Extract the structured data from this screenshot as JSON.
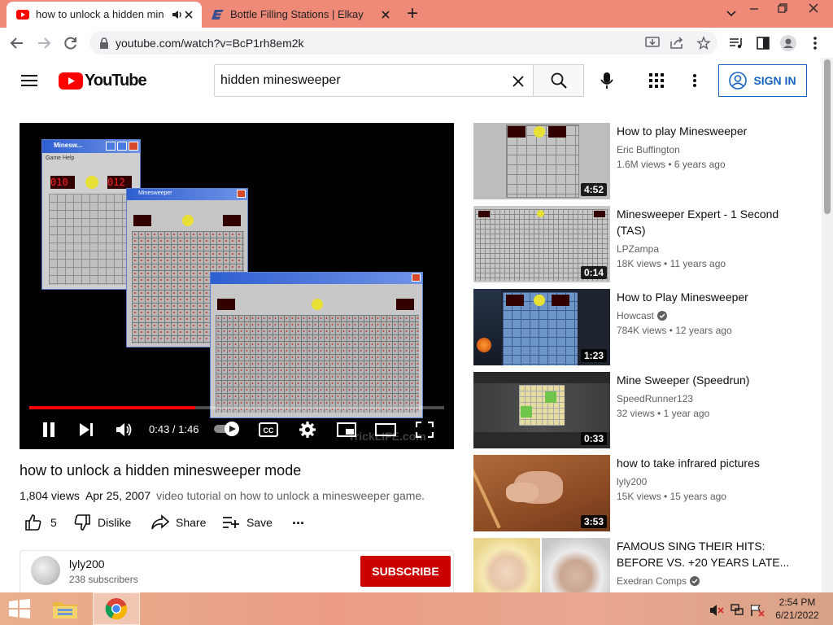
{
  "browser": {
    "tabs": [
      {
        "title": "how to unlock a hidden mine",
        "active": true
      },
      {
        "title": "Bottle Filling Stations | Elkay",
        "active": false
      }
    ],
    "new_tab": "+",
    "url": "youtube.com/watch?v=BcP1rh8em2k"
  },
  "masthead": {
    "logo_text": "YouTube",
    "search_value": "hidden minesweeper",
    "signin_label": "SIGN IN"
  },
  "player": {
    "time": "0:43 / 1:46",
    "watermark": "TrickLIFE.com",
    "progress": 0.4,
    "inner_window_title_1": "Minesw...",
    "inner_window_title_2": "Minesweeper",
    "inner_menu_1": "Game  Help",
    "inner_counter_1": "010",
    "inner_counter_2": "012"
  },
  "video": {
    "title": "how to unlock a hidden minesweeper mode",
    "views": "1,804 views",
    "date": "Apr 25, 2007",
    "description": "video tutorial on how to unlock a minesweeper game.",
    "likes": "5",
    "dislike_label": "Dislike",
    "share_label": "Share",
    "save_label": "Save",
    "more_label": "..."
  },
  "channel": {
    "name": "lyly200",
    "subscribers": "238 subscribers",
    "subscribe_label": "SUBSCRIBE"
  },
  "recommendations": [
    {
      "title": "How to play Minesweeper",
      "channel": "Eric Buffington",
      "verified": false,
      "views": "1.6M views",
      "age": "6 years ago",
      "duration": "4:52"
    },
    {
      "title": "Minesweeper Expert - 1 Second (TAS)",
      "channel": "LPZampa",
      "verified": false,
      "views": "18K views",
      "age": "11 years ago",
      "duration": "0:14"
    },
    {
      "title": "How to Play Minesweeper",
      "channel": "Howcast",
      "verified": true,
      "views": "784K views",
      "age": "12 years ago",
      "duration": "1:23"
    },
    {
      "title": "Mine Sweeper (Speedrun)",
      "channel": "SpeedRunner123",
      "verified": false,
      "views": "32 views",
      "age": "1 year ago",
      "duration": "0:33"
    },
    {
      "title": "how to take infrared pictures",
      "channel": "lyly200",
      "verified": false,
      "views": "15K views",
      "age": "15 years ago",
      "duration": "3:53"
    },
    {
      "title": "FAMOUS SING THEIR HITS: BEFORE VS. +20 YEARS LATE...",
      "channel": "Exedran Comps",
      "verified": true,
      "views": "",
      "age": "",
      "duration": ""
    }
  ],
  "taskbar": {
    "time": "2:54 PM",
    "date": "6/21/2022"
  },
  "colors": {
    "tabstrip": "#f08a78",
    "youtube_red": "#ff0000",
    "subscribe_red": "#cc0000",
    "signin_blue": "#1565c0",
    "progress_red": "#ff0000"
  }
}
